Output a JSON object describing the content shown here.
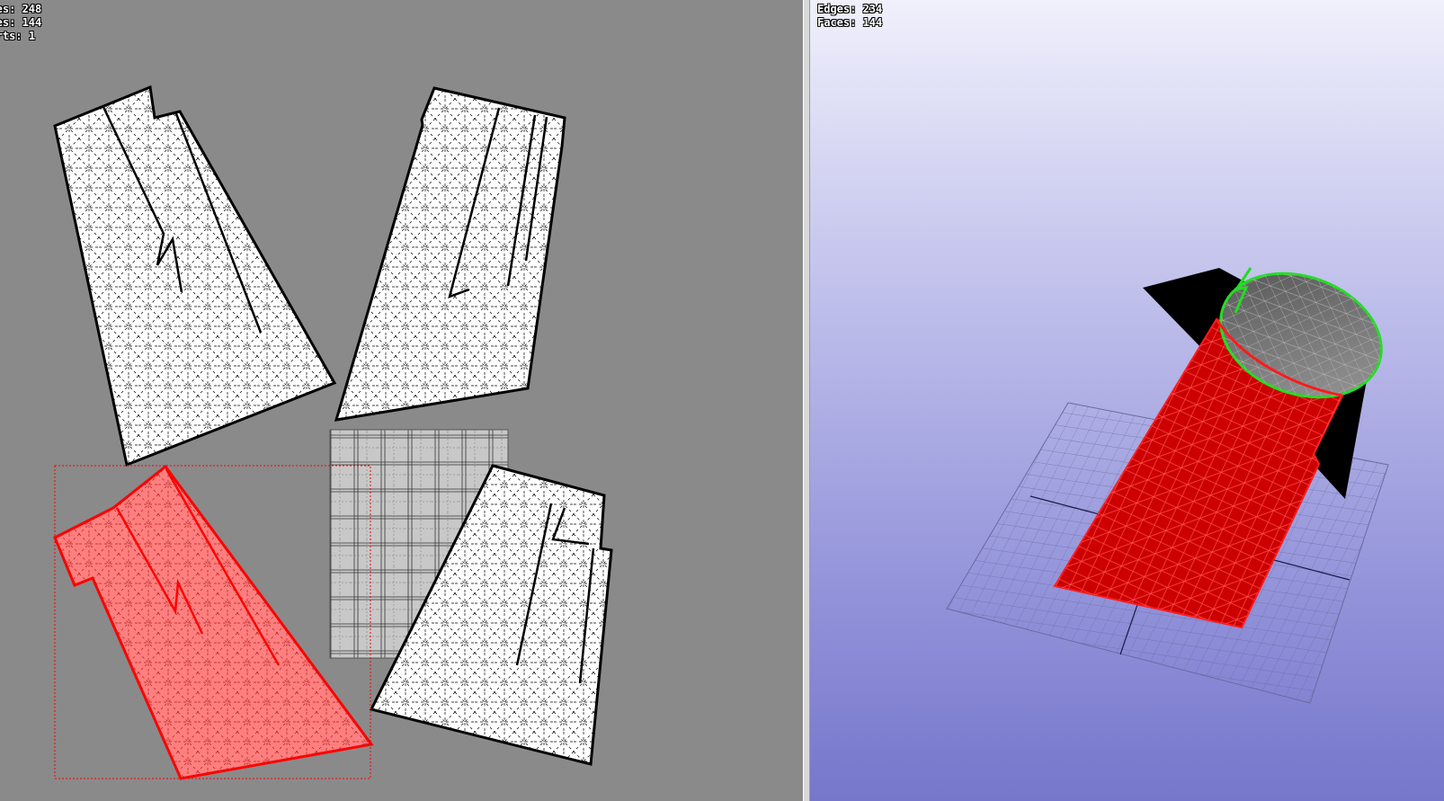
{
  "uv_view": {
    "stats": [
      {
        "label": "Edges",
        "value": "248"
      },
      {
        "label": "Faces",
        "value": "144"
      },
      {
        "label": "Charts",
        "value": "1"
      }
    ]
  },
  "view_3d": {
    "stats": [
      {
        "label": "Edges",
        "value": "234"
      },
      {
        "label": "Faces",
        "value": "144"
      }
    ]
  },
  "colors": {
    "uv_background": "#8a8a8a",
    "chart_fill": "#ffffff",
    "selected_chart_fill": "#ff7f7f",
    "selected_outline": "#ff0000",
    "mesh_red": "#cc0000",
    "boundary_green": "#22dd22",
    "grid": "#6a6aa0"
  }
}
